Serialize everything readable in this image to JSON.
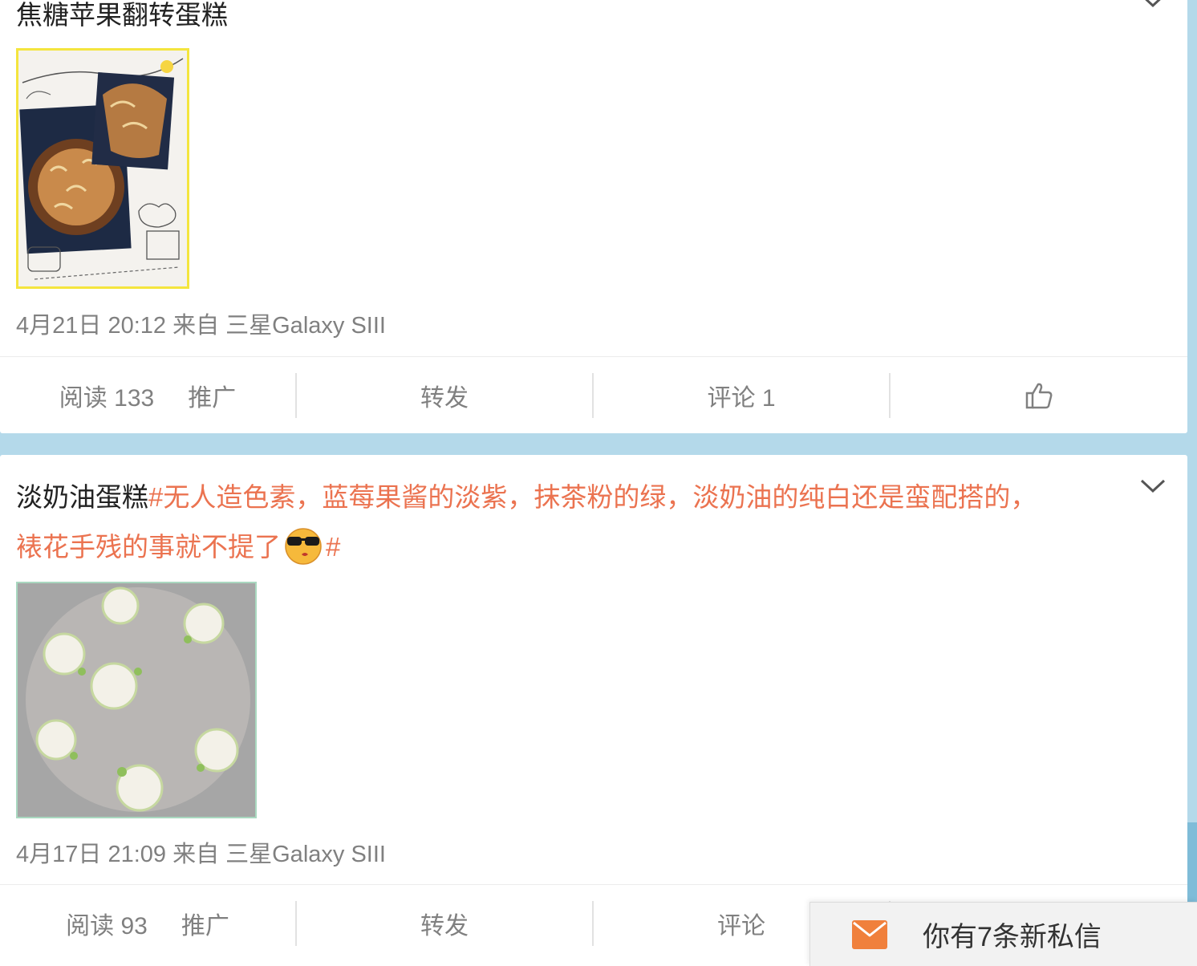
{
  "posts": [
    {
      "text": "焦糖苹果翻转蛋糕",
      "topic": "",
      "meta": "4月21日 20:12 来自 三星Galaxy SIII",
      "actions": {
        "read": "阅读 133",
        "promote": "推广",
        "repost": "转发",
        "comment": "评论 1"
      }
    },
    {
      "text": "淡奶油蛋糕",
      "topic_line1": "#无人造色素，蓝莓果酱的淡紫，抹茶粉的绿，淡奶油的纯白还是蛮配搭的，",
      "topic_line2": "裱花手残的事就不提了",
      "topic_end": "#",
      "meta": "4月17日 21:09 来自 三星Galaxy SIII",
      "actions": {
        "read": "阅读 93",
        "promote": "推广",
        "repost": "转发",
        "comment": "评论"
      }
    }
  ],
  "toast": {
    "text": "你有7条新私信",
    "icon": "mail-icon"
  },
  "colors": {
    "topic": "#eb7350",
    "background": "#b4d9ea",
    "toast_icon": "#f0803c"
  }
}
